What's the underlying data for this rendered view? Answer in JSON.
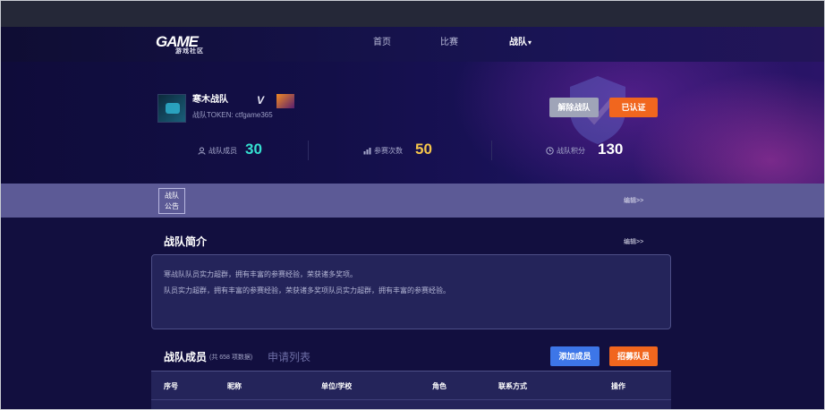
{
  "nav": {
    "logo_main": "GAME",
    "logo_sub": "游戏社区",
    "items": [
      {
        "label": "首页"
      },
      {
        "label": "比赛"
      },
      {
        "label": "战队"
      }
    ],
    "dropdown_arrow": "▾"
  },
  "team": {
    "name": "寒木战队",
    "token": "战队TOKEN: ctfgame365",
    "badge_text": "V",
    "buttons": {
      "dissolve": "解除战队",
      "verified": "已认证"
    },
    "stats": [
      {
        "label": "战队成员",
        "value": "30",
        "icon": "users-icon",
        "color": "#35e0d0"
      },
      {
        "label": "参赛次数",
        "value": "50",
        "icon": "chart-icon",
        "color": "#f6c54a"
      },
      {
        "label": "战队积分",
        "value": "130",
        "icon": "clock-icon",
        "color": "#ffffff"
      }
    ]
  },
  "notice": {
    "tag_line1": "战队",
    "tag_line2": "公告",
    "edit": "编辑>>"
  },
  "intro": {
    "title": "战队简介",
    "edit": "编辑>>",
    "lines": [
      "寒战队队员实力超群，拥有丰富的参赛经验，荣获诸多奖项。",
      "队员实力超群，拥有丰富的参赛经验，荣获诸多奖项队员实力超群，拥有丰富的参赛经验。"
    ]
  },
  "members": {
    "title": "战队成员",
    "count": "(共 658 项数据)",
    "apply_tab": "申请列表",
    "add_button": "添加成员",
    "recruit_button": "招募队员",
    "columns": [
      "序号",
      "昵称",
      "单位/学校",
      "角色",
      "联系方式",
      "操作"
    ]
  },
  "colors": {
    "accent_orange": "#f1661e",
    "accent_blue": "#3d76e8",
    "background": "#120f3f"
  }
}
